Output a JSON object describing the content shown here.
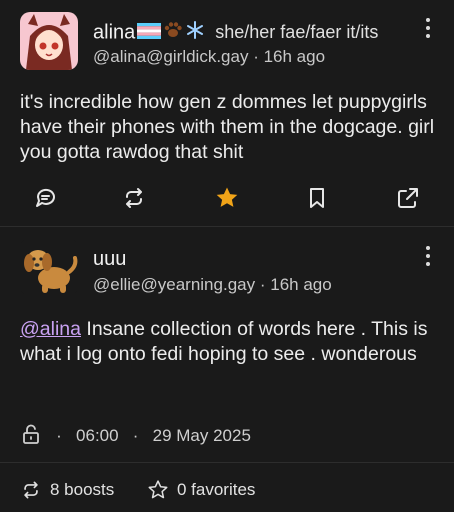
{
  "post1": {
    "author": "alina",
    "pronouns": "she/her fae/faer it/its",
    "handle": "@alina@girldick.gay",
    "age": "16h ago",
    "text": "it's incredible how gen z dommes let puppygirls have their phones with them in the dogcage. girl you gotta rawdog that shit",
    "icons": [
      "reply-icon",
      "boost-icon",
      "favorite-icon",
      "bookmark-icon",
      "share-icon"
    ],
    "favorited": true,
    "accent": "#f1a418"
  },
  "post2": {
    "author": "uuu",
    "handle": "@ellie@yearning.gay",
    "age": "16h ago",
    "mention": "@alina",
    "text": " Insane collection of words here . This is what i log onto fedi hoping to see . wonderous",
    "time": "06:00",
    "date": "29 May 2025",
    "boosts": "8 boosts",
    "favorites": "0 favorites",
    "mention_color": "#c9a2f2"
  }
}
